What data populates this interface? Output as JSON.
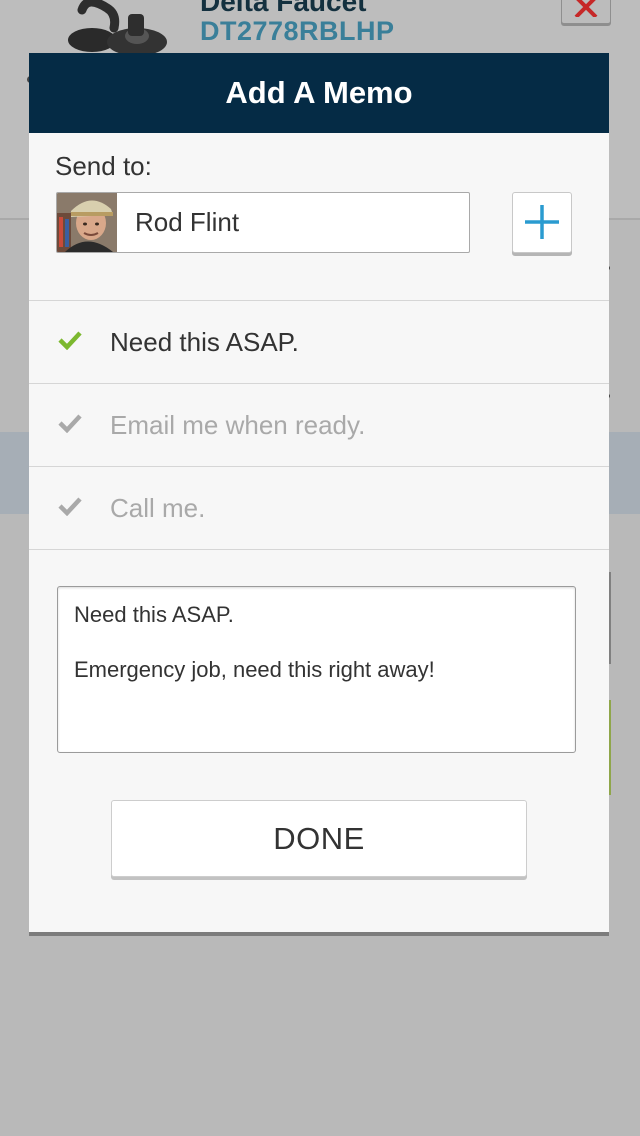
{
  "background": {
    "product_title": "Delta Faucet",
    "product_sku": "DT2778RBLHP"
  },
  "modal": {
    "title": "Add A Memo",
    "send_to_label": "Send to:",
    "recipient_name": "Rod Flint",
    "options": [
      {
        "label": "Need this ASAP.",
        "selected": true
      },
      {
        "label": "Email me when ready.",
        "selected": false
      },
      {
        "label": "Call me.",
        "selected": false
      }
    ],
    "memo_text": {
      "line1": "Need this ASAP.",
      "line2": "Emergency job, need this right away!"
    },
    "done_label": "DONE"
  },
  "colors": {
    "header_bg": "#052b45",
    "check_active": "#7cb82f",
    "check_inactive": "#a9a9a9",
    "accent_blue": "#2a9bd0",
    "close_red": "#c62828"
  },
  "icons": {
    "close": "close-icon",
    "add": "plus-icon",
    "check": "checkmark-icon"
  }
}
